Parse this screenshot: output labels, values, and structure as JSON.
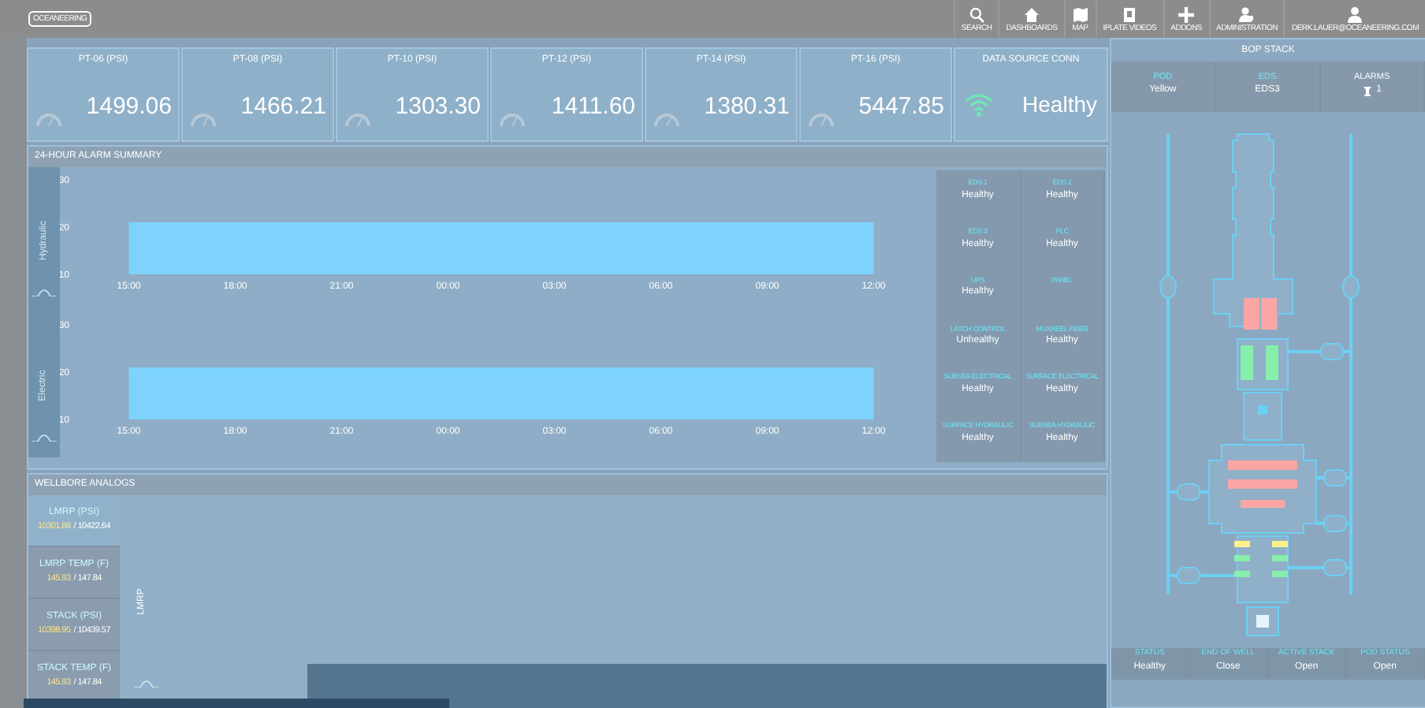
{
  "nav": {
    "logo": "OCEANEERING",
    "items": [
      {
        "label": "SEARCH",
        "kind": "search"
      },
      {
        "label": "DASHBOARDS",
        "kind": "home"
      },
      {
        "label": "MAP",
        "kind": "map"
      },
      {
        "label": "IPLATE VIDEOS",
        "kind": "video"
      },
      {
        "label": "ADDONS",
        "kind": "plus"
      },
      {
        "label": "ADMINISTRATION",
        "kind": "admin"
      },
      {
        "label": "DERK.LAUER@OCEANEERING.COM",
        "kind": "user"
      }
    ]
  },
  "gauges": [
    {
      "label": "PT-06 (PSI)",
      "value": "1499.06"
    },
    {
      "label": "PT-08 (PSI)",
      "value": "1466.21"
    },
    {
      "label": "PT-10 (PSI)",
      "value": "1303.30"
    },
    {
      "label": "PT-12 (PSI)",
      "value": "1411.60"
    },
    {
      "label": "PT-14 (PSI)",
      "value": "1380.31"
    },
    {
      "label": "PT-16 (PSI)",
      "value": "5447.85"
    }
  ],
  "data_source": {
    "label": "DATA SOURCE CONN",
    "value": "Healthy"
  },
  "alarm_summary": {
    "title": "24-HOUR ALARM SUMMARY",
    "charts": [
      {
        "chart_data": {
          "type": "area",
          "categories": [
            "15:00",
            "18:00",
            "21:00",
            "00:00",
            "03:00",
            "06:00",
            "09:00",
            "12:00"
          ],
          "ylim": [
            10,
            30
          ],
          "yticks": [
            10,
            20,
            30
          ],
          "series": [
            {
              "name": "Hydraulic",
              "color": "#7dd3fc",
              "values": [
                21,
                21,
                21,
                21,
                21,
                21,
                21,
                21
              ]
            }
          ]
        }
      },
      {
        "chart_data": {
          "type": "area",
          "categories": [
            "15:00",
            "18:00",
            "21:00",
            "00:00",
            "03:00",
            "06:00",
            "09:00",
            "12:00"
          ],
          "ylim": [
            10,
            30
          ],
          "yticks": [
            10,
            20,
            30
          ],
          "series": [
            {
              "name": "Electric",
              "color": "#7dd3fc",
              "values": [
                21,
                21,
                21,
                21,
                21,
                21,
                21,
                21
              ]
            }
          ]
        }
      }
    ]
  },
  "status_grid": [
    {
      "label": "EDS 1",
      "value": "Healthy"
    },
    {
      "label": "EDS 2",
      "value": "Healthy"
    },
    {
      "label": "EDS 3",
      "value": "Healthy"
    },
    {
      "label": "PLC",
      "value": "Healthy"
    },
    {
      "label": "UPS",
      "value": "Healthy"
    },
    {
      "label": "PANEL"
    },
    {
      "label": "LATCH CONTROL",
      "value": "Unhealthy"
    },
    {
      "label": "MUXREEL FIBER",
      "value": "Healthy"
    },
    {
      "label": "SUBSEA ELECTRICAL",
      "value": "Healthy"
    },
    {
      "label": "SURFACE ELECTRICAL",
      "value": "Healthy"
    },
    {
      "label": "SURFACE HYDRAULIC",
      "value": "Healthy"
    },
    {
      "label": "SUBSEA HYDRAULIC",
      "value": "Healthy"
    }
  ],
  "wellbore": {
    "title": "WELLBORE ANALOGS",
    "chart_label": "LMRP",
    "items": [
      {
        "label": "LMRP (PSI)",
        "current": "10301.88",
        "max": "/ 10422.64",
        "selected": true
      },
      {
        "label": "LMRP TEMP (F)",
        "current": "145.93",
        "max": "/ 147.84",
        "selected": false
      },
      {
        "label": "STACK (PSI)",
        "current": "10398.95",
        "max": "/ 10439.57",
        "selected": false
      },
      {
        "label": "STACK TEMP (F)",
        "current": "145.93",
        "max": "/ 147.84",
        "selected": false
      }
    ]
  },
  "bop_stack": {
    "title": "BOP STACK",
    "summary": [
      {
        "label": "POD",
        "value": "Yellow",
        "kind": "info"
      },
      {
        "label": "EDS",
        "value": "EDS3",
        "kind": "info"
      },
      {
        "label": "ALARMS",
        "value": "1",
        "kind": "alarm"
      }
    ],
    "footer": [
      {
        "label": "STATUS",
        "value": "Healthy"
      },
      {
        "label": "END OF WELL",
        "value": "Close"
      },
      {
        "label": "ACTIVE STACK",
        "value": "Open"
      },
      {
        "label": "POD STATUS",
        "value": "Open"
      }
    ]
  }
}
